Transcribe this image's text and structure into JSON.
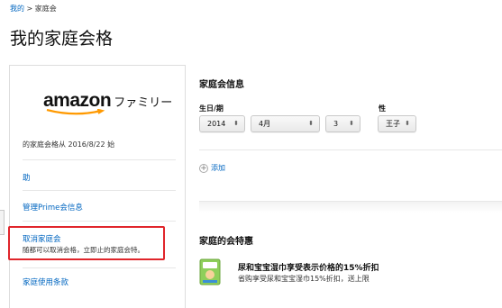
{
  "breadcrumb": {
    "parent": "我的",
    "separator": ">",
    "current": "家庭会"
  },
  "page_title": "我的家庭会格",
  "sidebar": {
    "logo_word": "amazon",
    "logo_jp": "ファミリー",
    "member_since": "的家庭会格从 2016/8/22 始",
    "links": {
      "help": "助",
      "prime_info": "管理Prime会信息",
      "cancel_title": "取消家庭会",
      "cancel_desc": "随都可以取消会格，立即止的家庭会特。",
      "terms": "家庭使用条款"
    }
  },
  "family_info": {
    "heading": "家庭会信息",
    "birthday_label": "生日/期",
    "gender_label": "性",
    "year": "2014",
    "month": "4月",
    "day": "3",
    "gender": "王子",
    "add_label": "添加"
  },
  "benefits": {
    "heading": "家庭的会特惠",
    "item_title": "尿和宝宝湿巾享受表示价格的15%折扣",
    "item_desc": "省购享受尿和宝宝湿巾15%折扣，送上限"
  },
  "colors": {
    "link": "#0066c0",
    "highlight_box": "#e0252b",
    "logo_smile": "#f90"
  }
}
